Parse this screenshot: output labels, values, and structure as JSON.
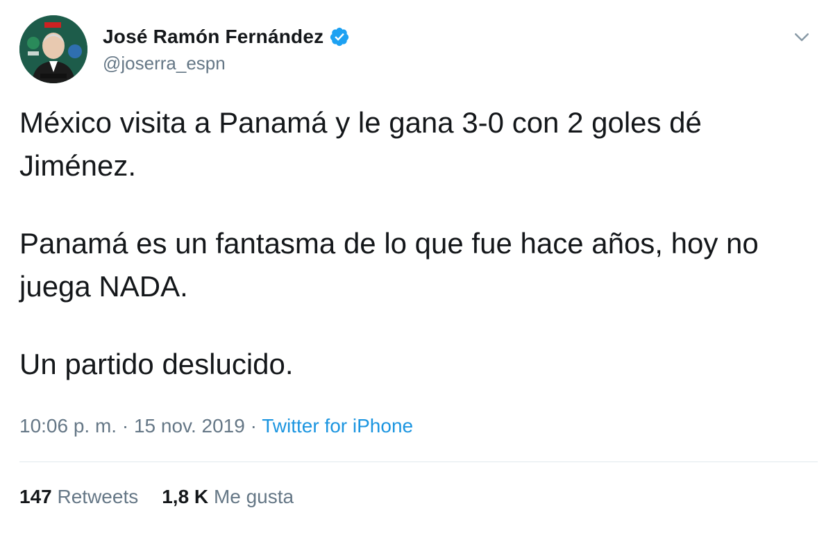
{
  "author": {
    "display_name": "José Ramón Fernández",
    "handle": "@joserra_espn",
    "verified": true,
    "avatar_icon": "profile-photo"
  },
  "tweet": {
    "paragraphs": [
      "México visita a Panamá y le gana 3-0 con 2 goles dé Jiménez.",
      "Panamá es un fantasma de lo que fue hace años, hoy no juega NADA.",
      "Un partido deslucido."
    ],
    "time": "10:06 p. m.",
    "separator": "·",
    "date": "15 nov. 2019",
    "source": "Twitter for iPhone"
  },
  "stats": {
    "retweets_count": "147",
    "retweets_label": "Retweets",
    "likes_count": "1,8 K",
    "likes_label": "Me gusta"
  },
  "colors": {
    "text": "#14171a",
    "secondary": "#657786",
    "link": "#1b95e0",
    "verified_badge": "#1da1f2",
    "divider": "#e1e8ed"
  }
}
